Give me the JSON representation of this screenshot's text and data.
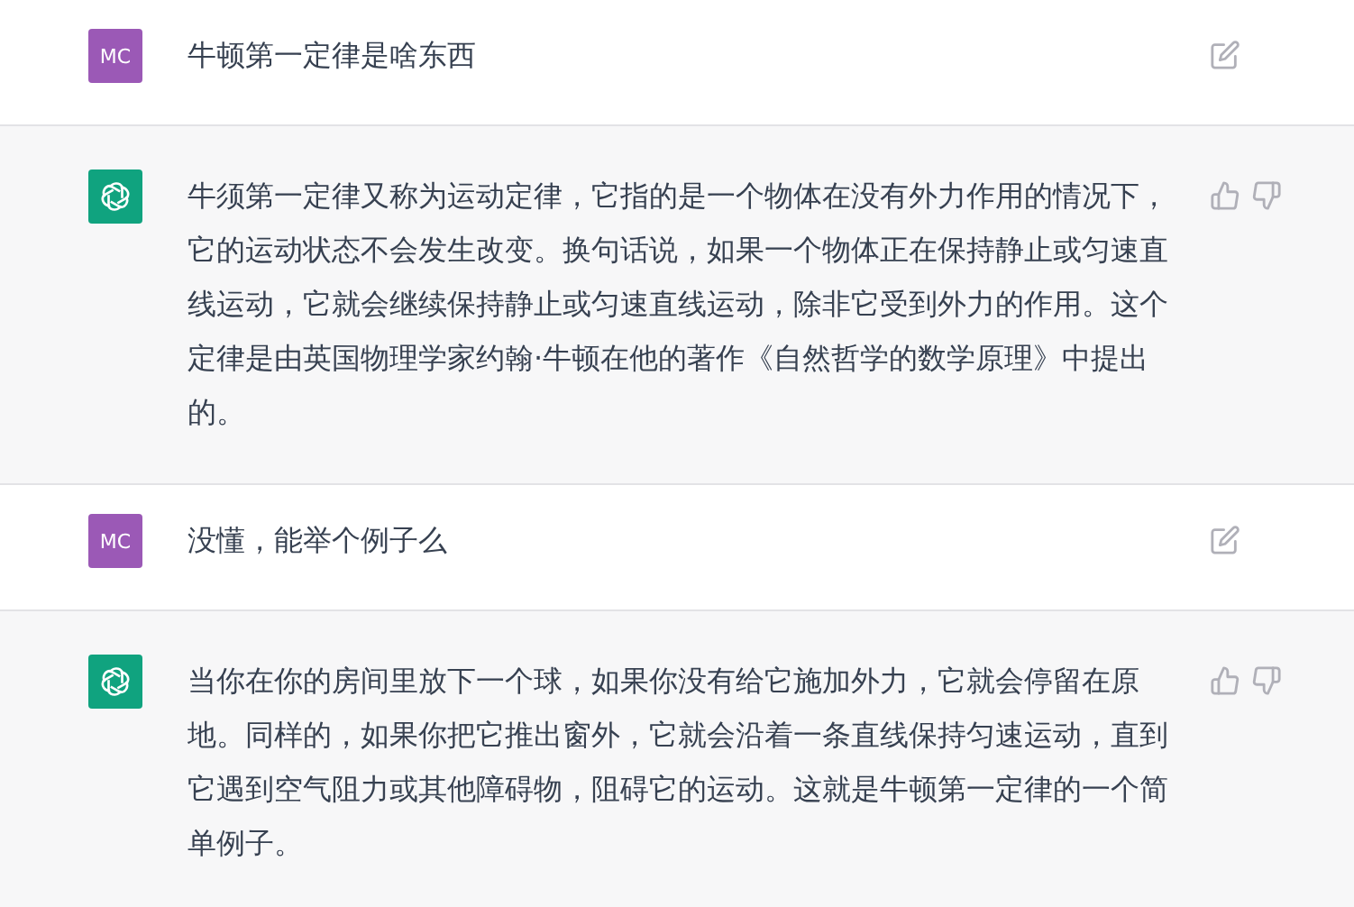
{
  "messages": [
    {
      "kind": "user",
      "avatar": "MC",
      "text": "牛顿第一定律是啥东西"
    },
    {
      "kind": "assistant",
      "text": "牛须第一定律又称为运动定律，它指的是一个物体在没有外力作用的情况下，它的运动状态不会发生改变。换句话说，如果一个物体正在保持静止或匀速直线运动，它就会继续保持静止或匀速直线运动，除非它受到外力的作用。这个定律是由英国物理学家约翰·牛顿在他的著作《自然哲学的数学原理》中提出的。"
    },
    {
      "kind": "user",
      "avatar": "MC",
      "text": "没懂，能举个例子么"
    },
    {
      "kind": "assistant",
      "text": "当你在你的房间里放下一个球，如果你没有给它施加外力，它就会停留在原地。同样的，如果你把它推出窗外，它就会沿着一条直线保持匀速运动，直到它遇到空气阻力或其他障碍物，阻碍它的运动。这就是牛顿第一定律的一个简单例子。"
    }
  ]
}
